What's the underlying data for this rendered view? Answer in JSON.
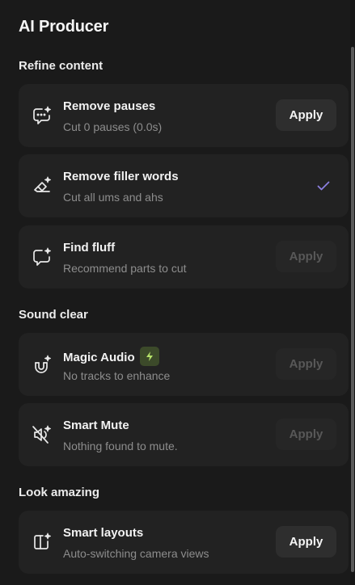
{
  "panel": {
    "title": "AI Producer"
  },
  "sections": [
    {
      "title": "Refine content",
      "items": [
        {
          "label": "Remove pauses",
          "sub": "Cut 0 pauses (0.0s)",
          "action": "Apply",
          "state": "enabled",
          "icon": "chat-sparkle-icon"
        },
        {
          "label": "Remove filler words",
          "sub": "Cut all ums and ahs",
          "action": "",
          "state": "done",
          "icon": "eraser-sparkle-icon"
        },
        {
          "label": "Find fluff",
          "sub": "Recommend parts to cut",
          "action": "Apply",
          "state": "disabled",
          "icon": "message-sparkle-icon"
        }
      ]
    },
    {
      "title": "Sound clear",
      "items": [
        {
          "label": "Magic Audio",
          "sub": "No tracks to enhance",
          "action": "Apply",
          "state": "disabled",
          "icon": "magnet-sparkle-icon",
          "badge": "lightning-icon"
        },
        {
          "label": "Smart Mute",
          "sub": "Nothing found to mute.",
          "action": "Apply",
          "state": "disabled",
          "icon": "mute-sparkle-icon"
        }
      ]
    },
    {
      "title": "Look amazing",
      "items": [
        {
          "label": "Smart layouts",
          "sub": "Auto-switching camera views",
          "action": "Apply",
          "state": "enabled",
          "icon": "layout-sparkle-icon"
        }
      ]
    }
  ],
  "colors": {
    "background": "#1a1a1a",
    "card": "#222222",
    "check": "#8b7fe0",
    "badge_bg": "#3c4a2a",
    "badge_fg": "#b6e36a"
  }
}
